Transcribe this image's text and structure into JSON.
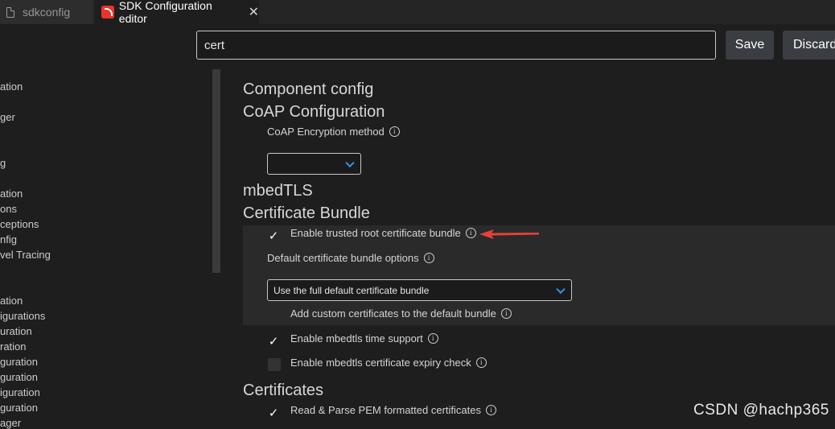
{
  "tabs": [
    {
      "label": "sdkconfig"
    },
    {
      "label": "SDK Configuration editor",
      "close": "✕"
    }
  ],
  "sidebar": {
    "items": [
      "ation",
      "ger",
      "g",
      "ation",
      "ons",
      "ceptions",
      "nfig",
      "vel Tracing",
      "ation",
      "igurations",
      "uration",
      "ration",
      "guration",
      "guration",
      "iguration",
      "guration",
      "ager"
    ]
  },
  "search": {
    "value": "cert"
  },
  "buttons": {
    "save": "Save",
    "discard": "Discard"
  },
  "main": {
    "component_config": "Component config",
    "coap_config": "CoAP Configuration",
    "coap_encryption_label": "CoAP Encryption method",
    "coap_encryption_value": "",
    "mbedtls": "mbedTLS",
    "cert_bundle": "Certificate Bundle",
    "enable_trusted_bundle": "Enable trusted root certificate bundle",
    "enable_trusted_bundle_checked": true,
    "default_bundle_options_label": "Default certificate bundle options",
    "default_bundle_options_value": "Use the full default certificate bundle",
    "add_custom_certs": "Add custom certificates to the default bundle",
    "mbedtls_time_support": "Enable mbedtls time support",
    "mbedtls_time_support_checked": true,
    "cert_expiry_check": "Enable mbedtls certificate expiry check",
    "cert_expiry_check_checked": false,
    "certificates": "Certificates",
    "read_parse_pem": "Read & Parse PEM formatted certificates",
    "read_parse_pem_checked": true,
    "info_glyph": "i",
    "check_glyph": "✓"
  },
  "watermark": "CSDN @hachp365",
  "colors": {
    "background": "#1e1e1e",
    "accent_chevron": "#3b8eea",
    "annotation_arrow": "#e8413a",
    "button_bg": "#3a3d41"
  }
}
